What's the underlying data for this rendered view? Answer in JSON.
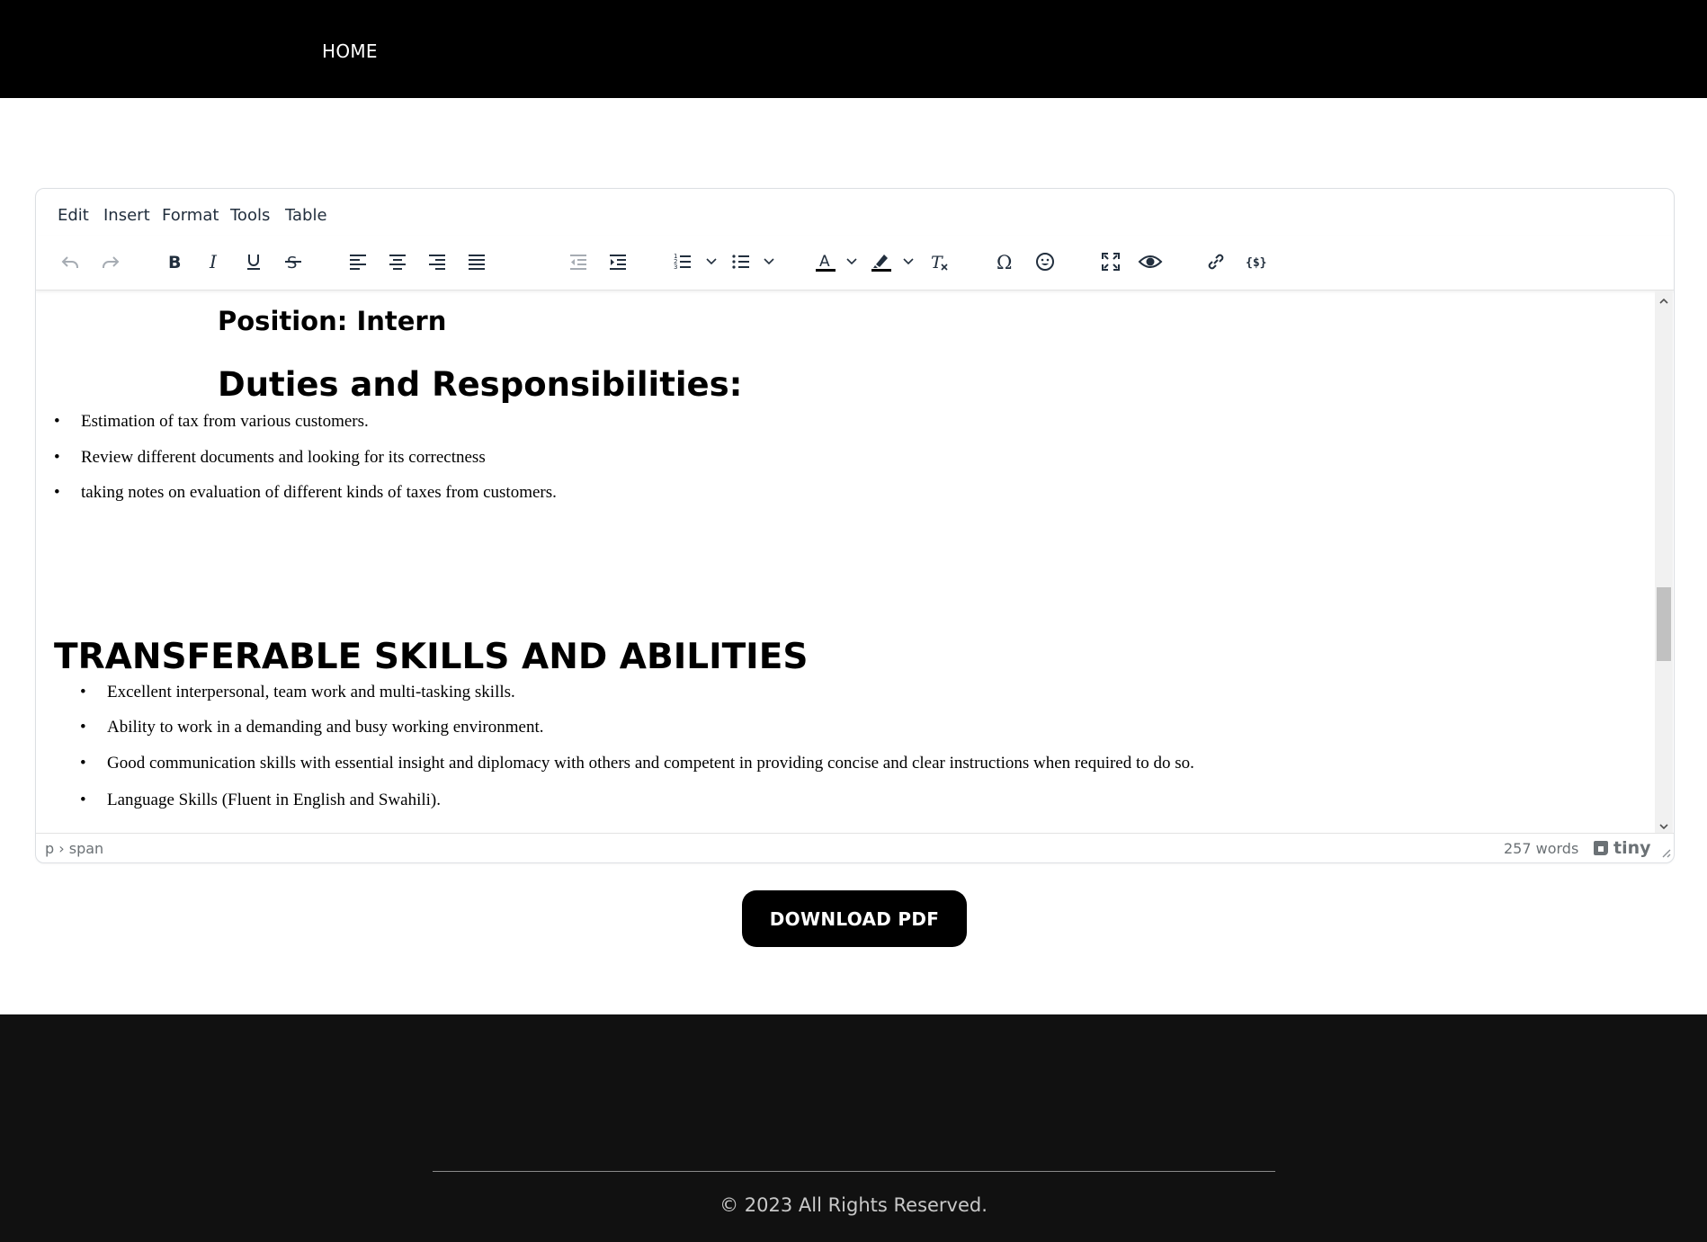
{
  "nav": {
    "home_label": "HOME"
  },
  "editor": {
    "menubar": [
      "Edit",
      "Insert",
      "Format",
      "Tools",
      "Table"
    ],
    "toolbar_icons": [
      "undo-icon",
      "redo-icon",
      "bold-icon",
      "italic-icon",
      "underline-icon",
      "strikethrough-icon",
      "align-left-icon",
      "align-center-icon",
      "align-right-icon",
      "justify-icon",
      "outdent-icon",
      "indent-icon",
      "numbered-list-icon",
      "bullet-list-icon",
      "text-color-icon",
      "highlight-color-icon",
      "clear-formatting-icon",
      "special-character-icon",
      "emoji-icon",
      "fullscreen-icon",
      "preview-icon",
      "link-icon",
      "code-icon"
    ],
    "content": {
      "position_heading": "Position: Intern",
      "duties_heading": "Duties and Responsibilities:",
      "duties": [
        "Estimation of tax from various customers.",
        "Review different documents and looking for its correctness",
        "taking notes on evaluation of different kinds of taxes from customers."
      ],
      "skills_heading": "TRANSFERABLE SKILLS AND ABILITIES",
      "skills": [
        "Excellent interpersonal, team work and multi-tasking skills.",
        "Ability to work in a demanding and busy working environment.",
        "Good communication skills with essential insight and diplomacy with others and competent in providing concise and clear instructions when required to do so.",
        "Language Skills (Fluent in English and Swahili)."
      ],
      "bullet_char": "•"
    },
    "statusbar": {
      "path": "p › span",
      "word_count": "257 words",
      "brand": "tiny"
    }
  },
  "download_button_label": "DOWNLOAD PDF",
  "footer": {
    "copyright": "© 2023 All Rights Reserved."
  }
}
